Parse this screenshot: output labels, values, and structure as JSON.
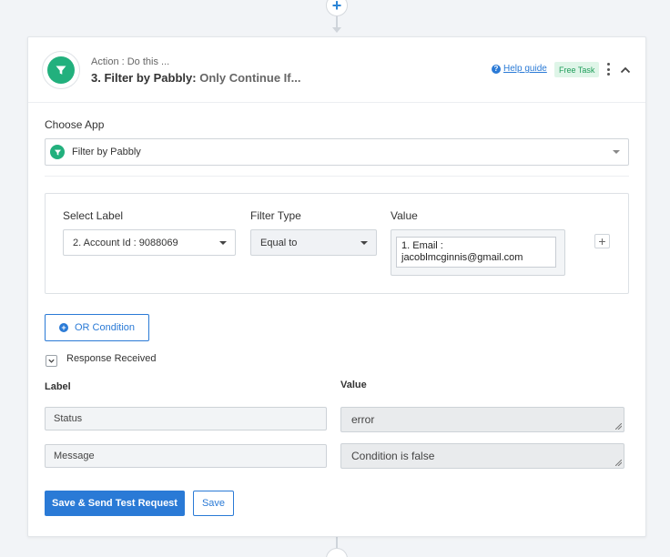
{
  "header": {
    "action_subtitle": "Action : Do this ...",
    "step_title": "3. Filter by Pabbly:",
    "step_event": "Only Continue If...",
    "help_guide_label": "Help guide",
    "free_task_badge": "Free Task"
  },
  "choose_app": {
    "label": "Choose App",
    "selected": "Filter by Pabbly"
  },
  "filter": {
    "select_label_heading": "Select Label",
    "select_label_value": "2. Account Id : 9088069",
    "filter_type_heading": "Filter Type",
    "filter_type_value": "Equal to",
    "value_heading": "Value",
    "value_line1": "1. Email :",
    "value_line2": "jacoblmcginnis@gmail.com",
    "add_condition_symbol": "+"
  },
  "or_condition_label": "OR Condition",
  "response": {
    "toggle_label": "Response Received",
    "label_heading": "Label",
    "value_heading": "Value",
    "rows": [
      {
        "label": "Status",
        "value": "error"
      },
      {
        "label": "Message",
        "value": "Condition is false"
      }
    ]
  },
  "actions": {
    "save_send_label": "Save & Send Test Request",
    "save_label": "Save"
  },
  "colors": {
    "accent": "#2a7ad6",
    "app_green": "#22b07d",
    "badge_green_bg": "#dff5e8",
    "badge_green_text": "#1f9d5a"
  },
  "icons": {
    "top_add": "plus-icon",
    "app_logo": "filter-funnel-icon",
    "menu": "kebab-menu-icon",
    "collapse": "chevron-up-icon"
  }
}
